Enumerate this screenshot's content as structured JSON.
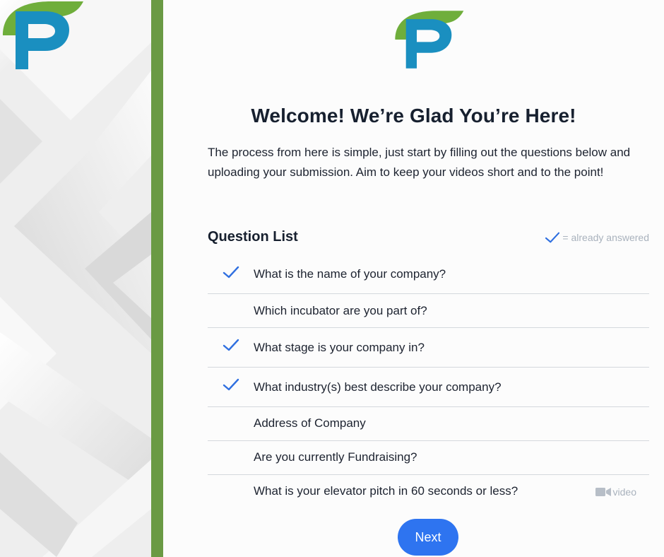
{
  "page": {
    "title": "Welcome! We’re Glad You’re Here!",
    "intro": "The process from here is simple, just start by filling out the questions below and uploading your submission. Aim to keep your videos short and to the point!"
  },
  "question_list": {
    "heading": "Question List",
    "legend_label": "= already answered",
    "questions": [
      {
        "text": "What is the name of your company?",
        "answered": true
      },
      {
        "text": "Which incubator are you part of?",
        "answered": false
      },
      {
        "text": "What stage is your company in?",
        "answered": true
      },
      {
        "text": "What industry(s) best describe your company?",
        "answered": true
      },
      {
        "text": "Address of Company",
        "answered": false
      },
      {
        "text": "Are you currently Fundraising?",
        "answered": false
      },
      {
        "text": "What is your elevator pitch in 60 seconds or less?",
        "answered": false,
        "tag": "video"
      }
    ]
  },
  "actions": {
    "next_label": "Next"
  },
  "colors": {
    "brand_green": "#6a9a44",
    "brand_blue": "#1a8fc0",
    "button_blue": "#2e74f0",
    "check_blue": "#2f6fe0"
  },
  "icons": {
    "check": "check-icon",
    "video": "video-camera-icon",
    "logo": "fp-logo"
  }
}
